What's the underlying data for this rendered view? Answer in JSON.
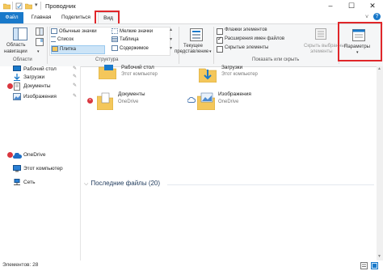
{
  "window": {
    "title": "Проводник",
    "controls": {
      "minimize": "–",
      "maximize": "☐",
      "close": "✕"
    }
  },
  "tabs": [
    "Файл",
    "Главная",
    "Поделиться",
    "Вид"
  ],
  "ribbon": {
    "panes": {
      "nav_pane_label_1": "Область",
      "nav_pane_label_2": "навигации",
      "group_label": "Области"
    },
    "layout": {
      "items": [
        "Обычные значки",
        "Список",
        "Плитка",
        "Мелкие значки",
        "Таблица",
        "Содержимое"
      ],
      "selected": "Плитка",
      "group_label": "Структура"
    },
    "current_view": {
      "label_1": "Текущее",
      "label_2": "представление"
    },
    "show_hide": {
      "checkboxes": [
        {
          "label": "Флажки элементов",
          "checked": false
        },
        {
          "label": "Расширения имен файлов",
          "checked": true
        },
        {
          "label": "Скрытые элементы",
          "checked": false
        }
      ],
      "hide_selected_1": "Скрыть выбранные",
      "hide_selected_2": "элементы",
      "group_label": "Показать или скрыть"
    },
    "options": {
      "label": "Параметры"
    }
  },
  "nav": {
    "items": [
      {
        "label": "Рабочий стол",
        "icon": "desktop-icon",
        "pinned": true
      },
      {
        "label": "Загрузки",
        "icon": "downloads-icon",
        "pinned": true
      },
      {
        "label": "Документы",
        "icon": "documents-icon",
        "pinned": true
      },
      {
        "label": "Изображения",
        "icon": "pictures-icon",
        "pinned": true
      },
      {
        "label": "OneDrive",
        "icon": "onedrive-icon"
      },
      {
        "label": "Этот компьютер",
        "icon": "computer-icon"
      },
      {
        "label": "Сеть",
        "icon": "network-icon"
      }
    ]
  },
  "main": {
    "tiles": [
      {
        "name": "Рабочий стол",
        "sub": "Этот компьютер"
      },
      {
        "name": "Загрузки",
        "sub": "Этот компьютер"
      },
      {
        "name": "Документы",
        "sub": "OneDrive"
      },
      {
        "name": "Изображения",
        "sub": "OneDrive"
      }
    ],
    "recent_header": "Последние файлы (20)"
  },
  "status": {
    "text": "Элементов: 28"
  },
  "colors": {
    "accent": "#1979ca",
    "highlight": "#e0262a",
    "folder": "#f4c75b"
  }
}
